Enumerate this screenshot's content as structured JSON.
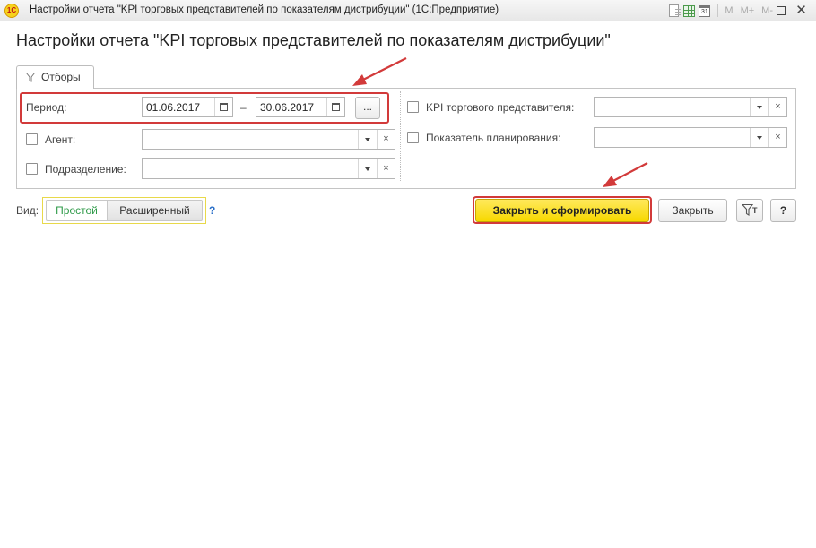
{
  "window": {
    "title": "Настройки отчета \"KPI торговых представителей по показателям дистрибуции\"  (1С:Предприятие)",
    "app_logo_text": "1С",
    "toolbar_icons": [
      "document-icon",
      "table-icon",
      "calendar-icon",
      "m-icon",
      "m-plus-icon",
      "m-minus-icon",
      "maximize-icon",
      "close-icon"
    ],
    "calendar_day": "31",
    "m_label": "M",
    "m_plus_label": "M+",
    "m_minus_label": "M-",
    "close_glyph": "✕"
  },
  "page": {
    "title": "Настройки отчета \"KPI торговых представителей по показателям дистрибуции\""
  },
  "tabs": [
    {
      "label": "Отборы",
      "icon": "filter-icon",
      "active": true
    }
  ],
  "filters": {
    "period": {
      "label": "Период:",
      "from": "01.06.2017",
      "separator": "–",
      "to": "30.06.2017",
      "more_label": "..."
    },
    "agent": {
      "label": "Агент:",
      "value": "",
      "checked": false
    },
    "department": {
      "label": "Подразделение:",
      "value": "",
      "checked": false
    },
    "kpi_rep": {
      "label": "KPI торгового представителя:",
      "value": "",
      "checked": false
    },
    "plan_indicator": {
      "label": "Показатель планирования:",
      "value": "",
      "checked": false
    },
    "clear_glyph": "×"
  },
  "view": {
    "label": "Вид:",
    "options": [
      {
        "label": "Простой",
        "active": true
      },
      {
        "label": "Расширенный",
        "active": false
      }
    ],
    "help": "?"
  },
  "actions": {
    "close_and_generate": "Закрыть и сформировать",
    "close": "Закрыть",
    "filter_settings_sub": "T",
    "help": "?"
  },
  "colors": {
    "highlight": "#d23a3a",
    "primary_button": "#f7d800",
    "active_view": "#2e9a48",
    "help_link": "#2a6fc8"
  }
}
